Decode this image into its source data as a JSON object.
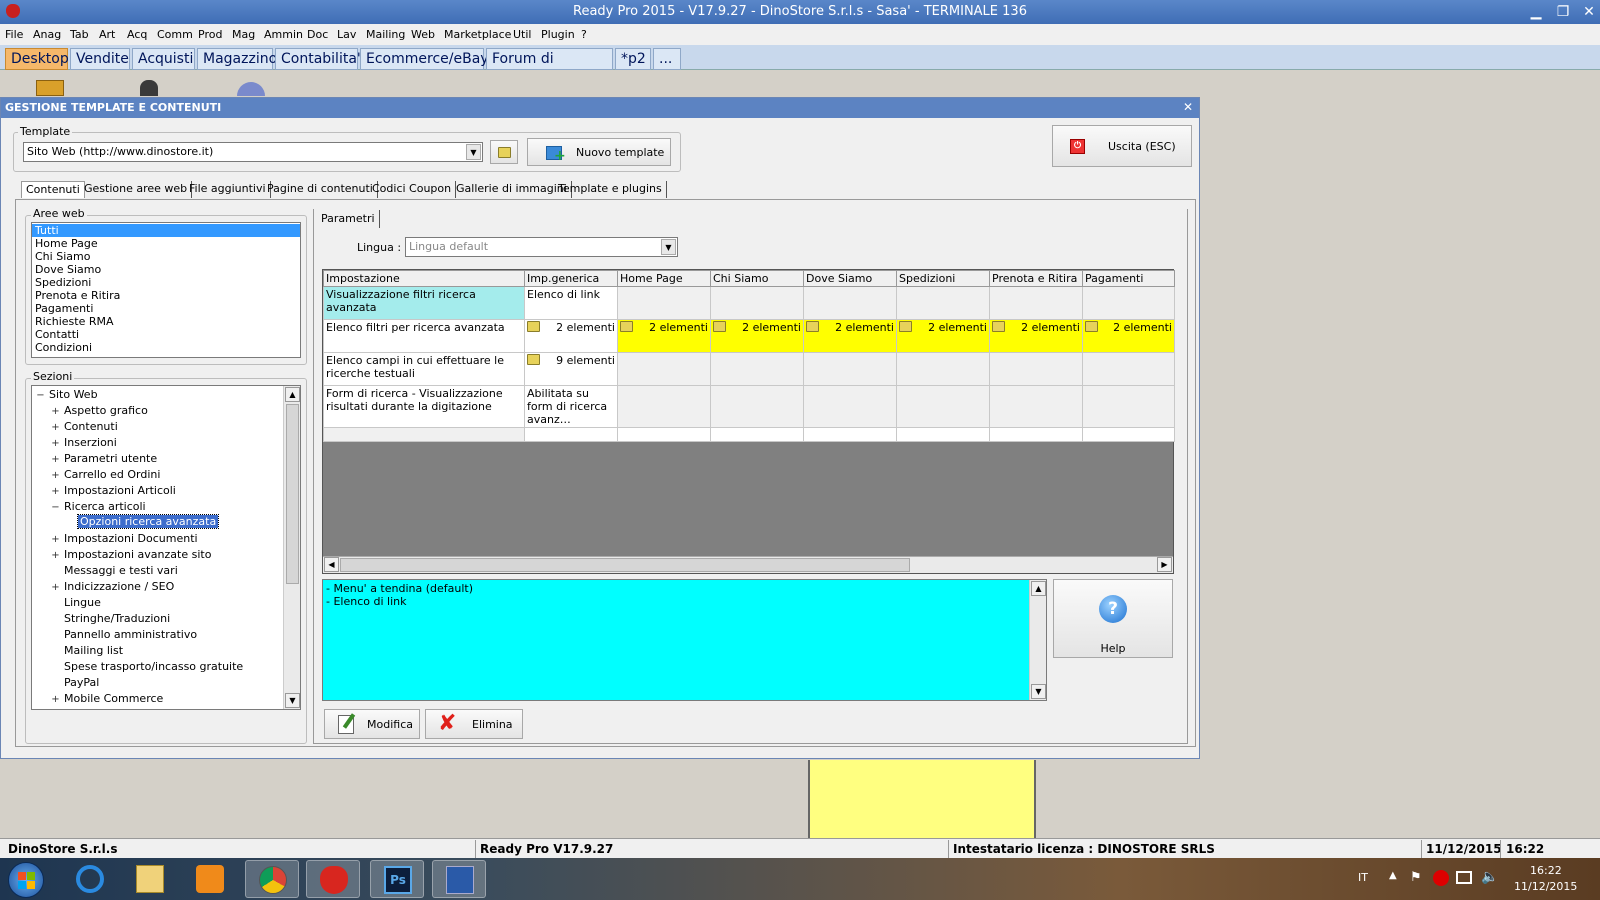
{
  "window": {
    "title": "Ready Pro 2015 - V17.9.27 - DinoStore S.r.l.s - Sasa' - TERMINALE 136",
    "minimize": "▁",
    "maximize": "❐",
    "close": "✕"
  },
  "menu": [
    "File",
    "Anag",
    "Tab",
    "Art",
    "Acq",
    "Comm",
    "Prod",
    "Mag",
    "Ammin",
    "Doc",
    "Lav",
    "Mailing",
    "Web",
    "Marketplace",
    "Util",
    "Plugin",
    "?"
  ],
  "module_tabs": [
    "Desktop",
    "Vendite",
    "Acquisti",
    "Magazzino",
    "Contabilita'",
    "Ecommerce/eBay",
    "Forum di supporto",
    "*p2",
    "..."
  ],
  "dialog": {
    "title": "GESTIONE TEMPLATE E CONTENUTI",
    "close": "✕",
    "template": {
      "label": "Template",
      "value": "Sito Web (http://www.dinostore.it)",
      "new_button": "Nuovo template"
    },
    "exit_button": "Uscita (ESC)",
    "tabs": [
      "Contenuti",
      "Gestione aree web",
      "File aggiuntivi",
      "Pagine di contenuti",
      "Codici Coupon",
      "Gallerie di immagini",
      "Template e plugins"
    ],
    "aree_web": {
      "label": "Aree web",
      "items": [
        "Tutti",
        "Home Page",
        "Chi Siamo",
        "Dove Siamo",
        "Spedizioni",
        "Prenota e Ritira",
        "Pagamenti",
        "Richieste RMA",
        "Contatti",
        "Condizioni"
      ],
      "selected": "Tutti"
    },
    "sezioni": {
      "label": "Sezioni",
      "root": "Sito Web",
      "root_expander": "−",
      "items": [
        {
          "label": "Aspetto grafico",
          "expander": "+"
        },
        {
          "label": "Contenuti",
          "expander": "+"
        },
        {
          "label": "Inserzioni",
          "expander": "+"
        },
        {
          "label": "Parametri utente",
          "expander": "+"
        },
        {
          "label": "Carrello ed Ordini",
          "expander": "+"
        },
        {
          "label": "Impostazioni Articoli",
          "expander": "+"
        },
        {
          "label": "Ricerca articoli",
          "expander": "−"
        },
        {
          "label": "Opzioni ricerca avanzata",
          "expander": "",
          "child": true
        },
        {
          "label": "Impostazioni Documenti",
          "expander": "+"
        },
        {
          "label": "Impostazioni avanzate sito",
          "expander": "+"
        },
        {
          "label": "Messaggi e testi vari",
          "expander": ""
        },
        {
          "label": "Indicizzazione / SEO",
          "expander": "+"
        },
        {
          "label": "Lingue",
          "expander": ""
        },
        {
          "label": "Stringhe/Traduzioni",
          "expander": ""
        },
        {
          "label": "Pannello amministrativo",
          "expander": ""
        },
        {
          "label": "Mailing list",
          "expander": ""
        },
        {
          "label": "Spese trasporto/incasso gratuite",
          "expander": ""
        },
        {
          "label": "PayPal",
          "expander": ""
        },
        {
          "label": "Mobile Commerce",
          "expander": "+"
        }
      ]
    },
    "params": {
      "tab": "Parametri",
      "lingua_label": "Lingua :",
      "lingua_value": "Lingua default",
      "columns": [
        "Impostazione",
        "Imp.generica",
        "Home Page",
        "Chi Siamo",
        "Dove Siamo",
        "Spedizioni",
        "Prenota e Ritira",
        "Pagamenti"
      ],
      "rows": [
        {
          "setting": "Visualizzazione filtri ricerca avanzata",
          "generic": "Elenco di link",
          "areas": [
            "",
            "",
            "",
            "",
            "",
            ""
          ],
          "highlight": "cyan"
        },
        {
          "setting": "Elenco filtri per ricerca avanzata",
          "generic": "2 elementi",
          "areas": [
            "2 elementi",
            "2 elementi",
            "2 elementi",
            "2 elementi",
            "2 elementi",
            "2 elementi"
          ],
          "highlight": "yellow"
        },
        {
          "setting": "Elenco campi in cui effettuare le ricerche testuali",
          "generic": "9 elementi",
          "areas": [
            "",
            "",
            "",
            "",
            "",
            ""
          ],
          "highlight": ""
        },
        {
          "setting": "Form di ricerca - Visualizzazione risultati durante la digitazione",
          "generic": "Abilitata su form di ricerca avanz…",
          "areas": [
            "",
            "",
            "",
            "",
            "",
            ""
          ],
          "highlight": ""
        }
      ]
    },
    "options_text": [
      "- Menu' a tendina (default)",
      "- Elenco di link"
    ],
    "help_button": "Help",
    "modify_button": "Modifica",
    "delete_button": "Elimina"
  },
  "status": {
    "company": "DinoStore S.r.l.s",
    "version": "Ready Pro V17.9.27",
    "license": "Intestatario licenza : DINOSTORE SRLS",
    "date": "11/12/2015",
    "time": "16:22"
  },
  "taskbar": {
    "lang": "IT",
    "time": "16:22",
    "date": "11/12/2015",
    "apps": [
      "start",
      "internet-explorer",
      "file-explorer",
      "media-player",
      "chrome",
      "ready-pro",
      "photoshop",
      "remote-desktop"
    ]
  },
  "colors": {
    "title_bar": "#3f6db5",
    "active_tab": "#f5b86a",
    "highlight_yellow": "#ffff00",
    "highlight_cyan": "#a4ecec",
    "options_bg": "#00ffff"
  }
}
